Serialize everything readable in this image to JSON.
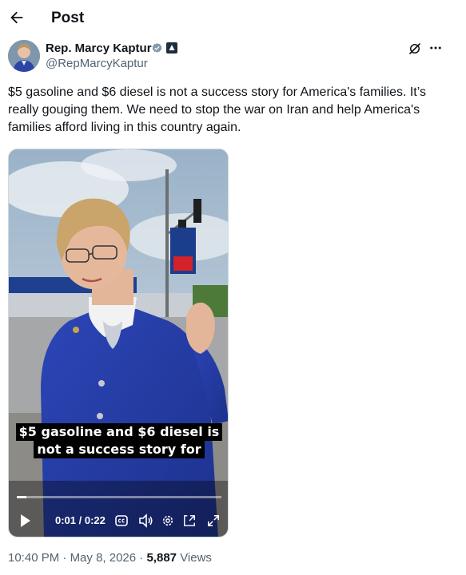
{
  "header": {
    "title": "Post"
  },
  "author": {
    "name": "Rep. Marcy Kaptur",
    "handle": "@RepMarcyKaptur"
  },
  "tweet": {
    "text": "$5 gasoline and $6 diesel is not a success story for America's families. It’s really gouging them. We need to stop the war on Iran and help America's families afford living in this country again."
  },
  "video": {
    "caption_line1": "$5 gasoline and $6 diesel is",
    "caption_line2": "not a success story for",
    "time_display": "0:01 / 0:22",
    "progress": 0.045
  },
  "meta": {
    "time": "10:40 PM",
    "date": "May 8, 2026",
    "views_count": "5,887",
    "views_label": "Views"
  },
  "icons": {
    "back": "arrow-left-icon",
    "verified": "verified-badge-icon",
    "gov": "government-badge-icon",
    "grok": "grok-icon",
    "more": "more-icon",
    "play": "play-icon",
    "captions": "captions-icon",
    "volume": "volume-icon",
    "settings": "settings-icon",
    "pip": "picture-in-picture-icon",
    "fullscreen": "fullscreen-icon"
  },
  "colors": {
    "verified": "#1d9bf0",
    "gov": "#1f2d3d",
    "secondary_text": "#536471"
  }
}
